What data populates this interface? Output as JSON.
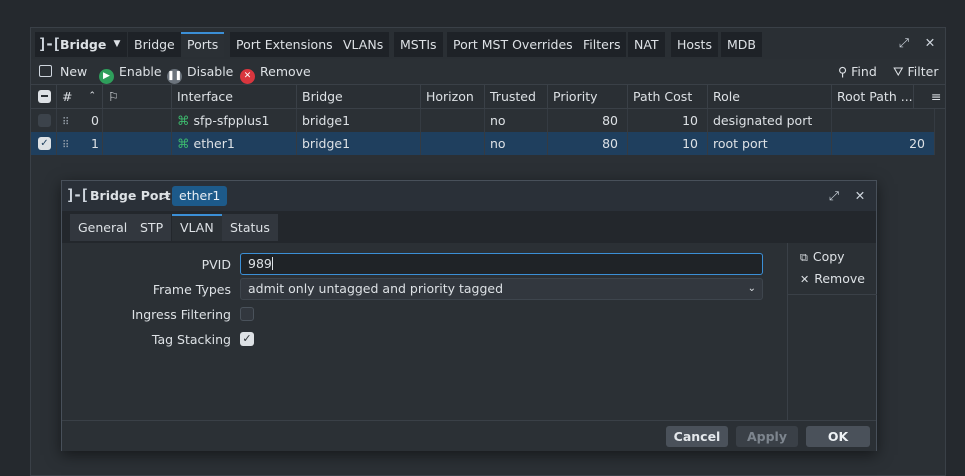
{
  "window": {
    "brand": "Bridge",
    "tabs": [
      "Bridge",
      "Ports",
      "Port Extensions",
      "VLANs",
      "MSTIs",
      "Port MST Overrides",
      "Filters",
      "NAT",
      "Hosts",
      "MDB"
    ],
    "active_tab": "Ports"
  },
  "toolbar": {
    "new_label": "New",
    "enable_label": "Enable",
    "disable_label": "Disable",
    "remove_label": "Remove",
    "find_label": "Find",
    "filter_label": "Filter"
  },
  "table": {
    "columns": [
      "#",
      "Interface",
      "Bridge",
      "Horizon",
      "Trusted",
      "Priority",
      "Path Cost",
      "Role",
      "Root Path ..."
    ],
    "rows": [
      {
        "num": "0",
        "interface": "sfp-sfpplus1",
        "bridge": "bridge1",
        "horizon": "",
        "trusted": "no",
        "priority": "80",
        "path_cost": "10",
        "role": "designated port",
        "root_path": "",
        "selected": false
      },
      {
        "num": "1",
        "interface": "ether1",
        "bridge": "bridge1",
        "horizon": "",
        "trusted": "no",
        "priority": "80",
        "path_cost": "10",
        "role": "root port",
        "root_path": "20",
        "selected": true
      }
    ]
  },
  "dialog": {
    "title": "Bridge Port",
    "separator": ">",
    "item": "ether1",
    "tabs": [
      "General",
      "STP",
      "VLAN",
      "Status"
    ],
    "active_tab": "VLAN",
    "fields": {
      "pvid_label": "PVID",
      "pvid_value": "989",
      "frame_types_label": "Frame Types",
      "frame_types_value": "admit only untagged and priority tagged",
      "ingress_filtering_label": "Ingress Filtering",
      "ingress_filtering_checked": false,
      "tag_stacking_label": "Tag Stacking",
      "tag_stacking_checked": true
    },
    "side": {
      "copy_label": "Copy",
      "remove_label": "Remove"
    },
    "footer": {
      "cancel_label": "Cancel",
      "apply_label": "Apply",
      "ok_label": "OK"
    }
  },
  "colors": {
    "accent": "#3b8fd6",
    "selected_row": "#1f3f5e",
    "enable_green": "#2e9e5b",
    "remove_red": "#d9363e"
  }
}
